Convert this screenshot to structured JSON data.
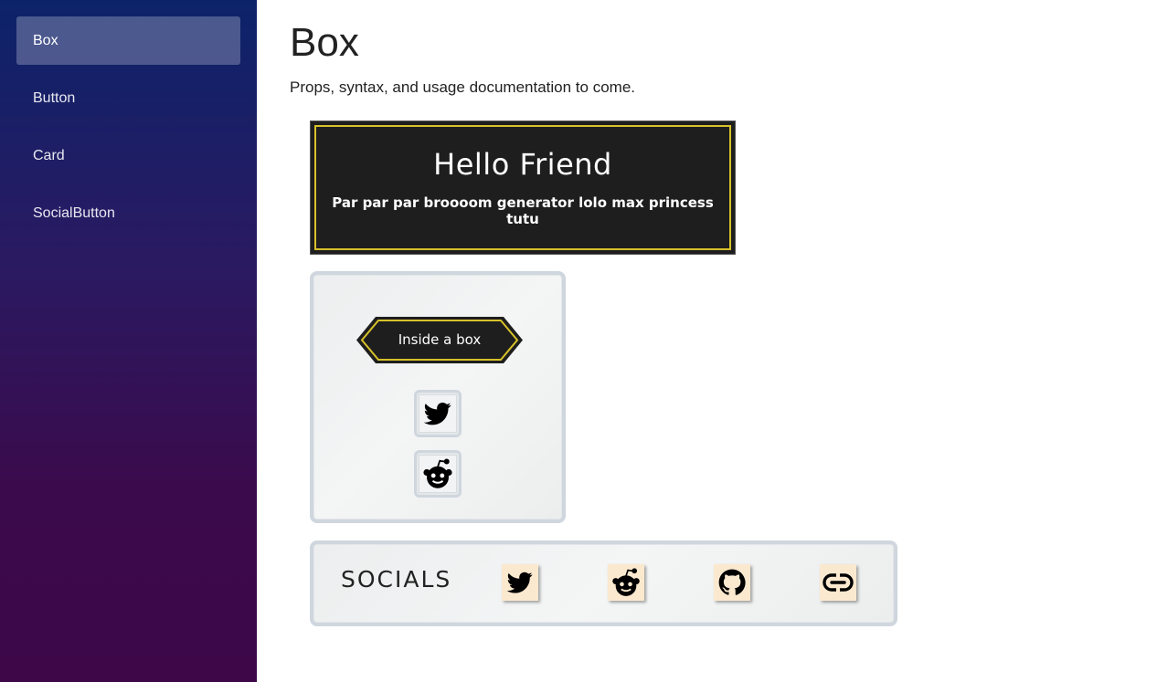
{
  "sidebar": {
    "items": [
      {
        "label": "Box",
        "active": true
      },
      {
        "label": "Button",
        "active": false
      },
      {
        "label": "Card",
        "active": false
      },
      {
        "label": "SocialButton",
        "active": false
      }
    ]
  },
  "page": {
    "title": "Box",
    "description": "Props, syntax, and usage documentation to come."
  },
  "hello_box": {
    "title": "Hello Friend",
    "text": "Par par par broooom generator lolo max princess tutu"
  },
  "inner_box": {
    "button_label": "Inside a box",
    "icons": [
      "twitter-icon",
      "reddit-icon"
    ]
  },
  "socials_box": {
    "label": "SOCIALS",
    "icons": [
      "twitter-icon",
      "reddit-icon",
      "github-icon",
      "link-icon"
    ]
  },
  "colors": {
    "sidebar_top": "#0c236a",
    "sidebar_bottom": "#3d0748",
    "dark_box": "#1e1e1e",
    "accent_gold": "#d7c12a",
    "social_button_bg": "#fbe9cf",
    "box_border": "#cfd6dd"
  }
}
